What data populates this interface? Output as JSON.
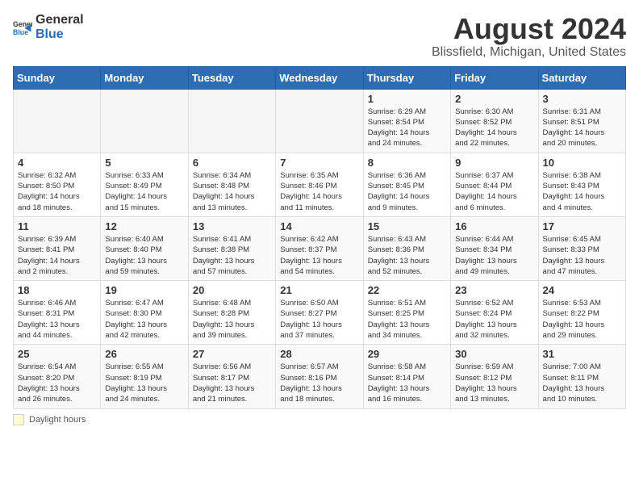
{
  "logo": {
    "general": "General",
    "blue": "Blue"
  },
  "title": "August 2024",
  "location": "Blissfield, Michigan, United States",
  "weekdays": [
    "Sunday",
    "Monday",
    "Tuesday",
    "Wednesday",
    "Thursday",
    "Friday",
    "Saturday"
  ],
  "footer": {
    "label": "Daylight hours"
  },
  "weeks": [
    [
      {
        "day": "",
        "info": ""
      },
      {
        "day": "",
        "info": ""
      },
      {
        "day": "",
        "info": ""
      },
      {
        "day": "",
        "info": ""
      },
      {
        "day": "1",
        "info": "Sunrise: 6:29 AM\nSunset: 8:54 PM\nDaylight: 14 hours\nand 24 minutes."
      },
      {
        "day": "2",
        "info": "Sunrise: 6:30 AM\nSunset: 8:52 PM\nDaylight: 14 hours\nand 22 minutes."
      },
      {
        "day": "3",
        "info": "Sunrise: 6:31 AM\nSunset: 8:51 PM\nDaylight: 14 hours\nand 20 minutes."
      }
    ],
    [
      {
        "day": "4",
        "info": "Sunrise: 6:32 AM\nSunset: 8:50 PM\nDaylight: 14 hours\nand 18 minutes."
      },
      {
        "day": "5",
        "info": "Sunrise: 6:33 AM\nSunset: 8:49 PM\nDaylight: 14 hours\nand 15 minutes."
      },
      {
        "day": "6",
        "info": "Sunrise: 6:34 AM\nSunset: 8:48 PM\nDaylight: 14 hours\nand 13 minutes."
      },
      {
        "day": "7",
        "info": "Sunrise: 6:35 AM\nSunset: 8:46 PM\nDaylight: 14 hours\nand 11 minutes."
      },
      {
        "day": "8",
        "info": "Sunrise: 6:36 AM\nSunset: 8:45 PM\nDaylight: 14 hours\nand 9 minutes."
      },
      {
        "day": "9",
        "info": "Sunrise: 6:37 AM\nSunset: 8:44 PM\nDaylight: 14 hours\nand 6 minutes."
      },
      {
        "day": "10",
        "info": "Sunrise: 6:38 AM\nSunset: 8:43 PM\nDaylight: 14 hours\nand 4 minutes."
      }
    ],
    [
      {
        "day": "11",
        "info": "Sunrise: 6:39 AM\nSunset: 8:41 PM\nDaylight: 14 hours\nand 2 minutes."
      },
      {
        "day": "12",
        "info": "Sunrise: 6:40 AM\nSunset: 8:40 PM\nDaylight: 13 hours\nand 59 minutes."
      },
      {
        "day": "13",
        "info": "Sunrise: 6:41 AM\nSunset: 8:38 PM\nDaylight: 13 hours\nand 57 minutes."
      },
      {
        "day": "14",
        "info": "Sunrise: 6:42 AM\nSunset: 8:37 PM\nDaylight: 13 hours\nand 54 minutes."
      },
      {
        "day": "15",
        "info": "Sunrise: 6:43 AM\nSunset: 8:36 PM\nDaylight: 13 hours\nand 52 minutes."
      },
      {
        "day": "16",
        "info": "Sunrise: 6:44 AM\nSunset: 8:34 PM\nDaylight: 13 hours\nand 49 minutes."
      },
      {
        "day": "17",
        "info": "Sunrise: 6:45 AM\nSunset: 8:33 PM\nDaylight: 13 hours\nand 47 minutes."
      }
    ],
    [
      {
        "day": "18",
        "info": "Sunrise: 6:46 AM\nSunset: 8:31 PM\nDaylight: 13 hours\nand 44 minutes."
      },
      {
        "day": "19",
        "info": "Sunrise: 6:47 AM\nSunset: 8:30 PM\nDaylight: 13 hours\nand 42 minutes."
      },
      {
        "day": "20",
        "info": "Sunrise: 6:48 AM\nSunset: 8:28 PM\nDaylight: 13 hours\nand 39 minutes."
      },
      {
        "day": "21",
        "info": "Sunrise: 6:50 AM\nSunset: 8:27 PM\nDaylight: 13 hours\nand 37 minutes."
      },
      {
        "day": "22",
        "info": "Sunrise: 6:51 AM\nSunset: 8:25 PM\nDaylight: 13 hours\nand 34 minutes."
      },
      {
        "day": "23",
        "info": "Sunrise: 6:52 AM\nSunset: 8:24 PM\nDaylight: 13 hours\nand 32 minutes."
      },
      {
        "day": "24",
        "info": "Sunrise: 6:53 AM\nSunset: 8:22 PM\nDaylight: 13 hours\nand 29 minutes."
      }
    ],
    [
      {
        "day": "25",
        "info": "Sunrise: 6:54 AM\nSunset: 8:20 PM\nDaylight: 13 hours\nand 26 minutes."
      },
      {
        "day": "26",
        "info": "Sunrise: 6:55 AM\nSunset: 8:19 PM\nDaylight: 13 hours\nand 24 minutes."
      },
      {
        "day": "27",
        "info": "Sunrise: 6:56 AM\nSunset: 8:17 PM\nDaylight: 13 hours\nand 21 minutes."
      },
      {
        "day": "28",
        "info": "Sunrise: 6:57 AM\nSunset: 8:16 PM\nDaylight: 13 hours\nand 18 minutes."
      },
      {
        "day": "29",
        "info": "Sunrise: 6:58 AM\nSunset: 8:14 PM\nDaylight: 13 hours\nand 16 minutes."
      },
      {
        "day": "30",
        "info": "Sunrise: 6:59 AM\nSunset: 8:12 PM\nDaylight: 13 hours\nand 13 minutes."
      },
      {
        "day": "31",
        "info": "Sunrise: 7:00 AM\nSunset: 8:11 PM\nDaylight: 13 hours\nand 10 minutes."
      }
    ]
  ]
}
